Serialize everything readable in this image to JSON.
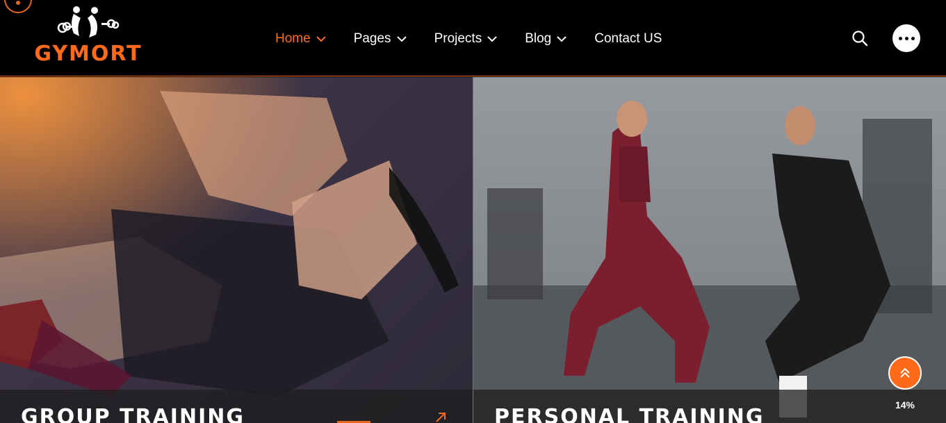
{
  "brand": {
    "name": "GYMORT",
    "accent": "#ff6a1a"
  },
  "nav": {
    "items": [
      {
        "label": "Home",
        "active": true,
        "has_dropdown": true
      },
      {
        "label": "Pages",
        "has_dropdown": true
      },
      {
        "label": "Projects",
        "has_dropdown": true
      },
      {
        "label": "Blog",
        "has_dropdown": true
      },
      {
        "label": "Contact US",
        "has_dropdown": false
      }
    ]
  },
  "header_icons": {
    "search": "search-icon",
    "more": "more-dots-icon"
  },
  "panels": [
    {
      "title": "GROUP TRAINING",
      "image": "group-training-photo",
      "arrow": "arrow-up-right-icon"
    },
    {
      "title": "PERSONAL TRAINING",
      "image": "personal-training-photo"
    }
  ],
  "scroll": {
    "icon": "double-chevron-up-icon",
    "progress_label": "14%",
    "progress": 14
  }
}
